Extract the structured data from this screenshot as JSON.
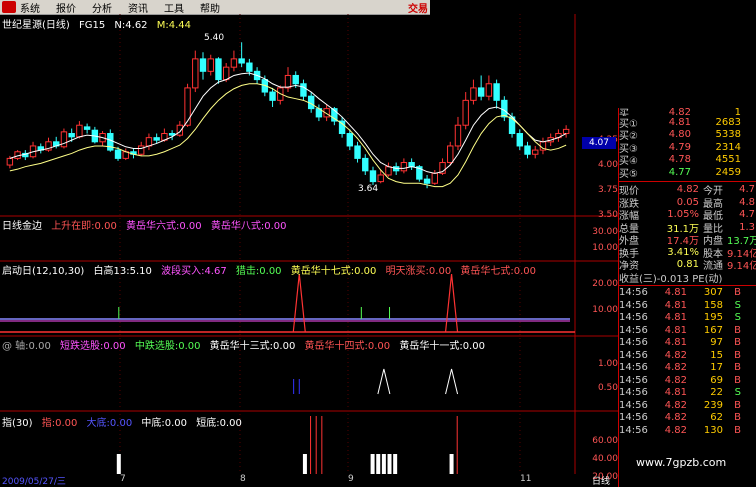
{
  "menu": {
    "items": [
      "系统",
      "报价",
      "分析",
      "资讯",
      "工具",
      "帮助"
    ],
    "trade": "交易"
  },
  "main_title": {
    "name": "世纪星源(日线)",
    "code": "FG15",
    "n": "N:4.62",
    "m": "M:4.44"
  },
  "price_chart": {
    "axis": [
      "4.25",
      "4.00",
      "3.75",
      "3.50"
    ],
    "current_price": "4.07",
    "high_label": "5.40",
    "low_label": "3.64",
    "candles": [
      [
        3.92,
        4.0,
        3.88,
        4.03
      ],
      [
        4.0,
        4.08,
        3.98,
        4.1
      ],
      [
        4.06,
        4.02,
        3.98,
        4.1
      ],
      [
        4.02,
        4.15,
        4.0,
        4.2
      ],
      [
        4.14,
        4.1,
        4.06,
        4.18
      ],
      [
        4.1,
        4.2,
        4.08,
        4.25
      ],
      [
        4.2,
        4.15,
        4.12,
        4.26
      ],
      [
        4.14,
        4.32,
        4.12,
        4.36
      ],
      [
        4.3,
        4.26,
        4.2,
        4.36
      ],
      [
        4.26,
        4.4,
        4.24,
        4.45
      ],
      [
        4.38,
        4.35,
        4.3,
        4.42
      ],
      [
        4.34,
        4.2,
        4.18,
        4.38
      ],
      [
        4.2,
        4.3,
        4.15,
        4.33
      ],
      [
        4.3,
        4.1,
        4.08,
        4.35
      ],
      [
        4.1,
        4.0,
        3.97,
        4.14
      ],
      [
        4.0,
        4.08,
        3.98,
        4.12
      ],
      [
        4.08,
        4.05,
        4.0,
        4.12
      ],
      [
        4.05,
        4.15,
        4.03,
        4.2
      ],
      [
        4.15,
        4.25,
        4.1,
        4.3
      ],
      [
        4.25,
        4.22,
        4.18,
        4.3
      ],
      [
        4.22,
        4.3,
        4.2,
        4.36
      ],
      [
        4.3,
        4.28,
        4.22,
        4.34
      ],
      [
        4.28,
        4.4,
        4.26,
        4.45
      ],
      [
        4.4,
        4.85,
        4.38,
        4.9
      ],
      [
        4.85,
        5.2,
        4.8,
        5.3
      ],
      [
        5.2,
        5.05,
        4.95,
        5.28
      ],
      [
        5.05,
        5.2,
        5.0,
        5.25
      ],
      [
        5.2,
        4.95,
        4.9,
        5.22
      ],
      [
        4.95,
        5.1,
        4.92,
        5.15
      ],
      [
        5.1,
        5.2,
        5.05,
        5.3
      ],
      [
        5.2,
        5.15,
        5.1,
        5.4
      ],
      [
        5.15,
        5.05,
        5.0,
        5.2
      ],
      [
        5.05,
        4.95,
        4.9,
        5.1
      ],
      [
        4.95,
        4.8,
        4.75,
        5.0
      ],
      [
        4.8,
        4.7,
        4.62,
        4.85
      ],
      [
        4.7,
        4.85,
        4.65,
        4.88
      ],
      [
        4.85,
        5.0,
        4.8,
        5.1
      ],
      [
        5.0,
        4.9,
        4.85,
        5.05
      ],
      [
        4.9,
        4.75,
        4.7,
        4.95
      ],
      [
        4.75,
        4.6,
        4.55,
        4.8
      ],
      [
        4.6,
        4.5,
        4.45,
        4.65
      ],
      [
        4.5,
        4.6,
        4.45,
        4.65
      ],
      [
        4.6,
        4.45,
        4.4,
        4.62
      ],
      [
        4.45,
        4.3,
        4.25,
        4.5
      ],
      [
        4.3,
        4.15,
        4.1,
        4.35
      ],
      [
        4.15,
        4.0,
        3.95,
        4.2
      ],
      [
        4.0,
        3.85,
        3.8,
        4.05
      ],
      [
        3.85,
        3.72,
        3.68,
        3.9
      ],
      [
        3.72,
        3.8,
        3.7,
        3.86
      ],
      [
        3.8,
        3.9,
        3.78,
        3.95
      ],
      [
        3.9,
        3.85,
        3.8,
        3.95
      ],
      [
        3.85,
        3.95,
        3.82,
        4.0
      ],
      [
        3.95,
        3.9,
        3.86,
        4.0
      ],
      [
        3.9,
        3.75,
        3.72,
        3.92
      ],
      [
        3.75,
        3.7,
        3.64,
        3.8
      ],
      [
        3.7,
        3.82,
        3.68,
        3.86
      ],
      [
        3.82,
        3.95,
        3.8,
        4.0
      ],
      [
        3.95,
        4.15,
        3.92,
        4.2
      ],
      [
        4.15,
        4.4,
        4.1,
        4.5
      ],
      [
        4.4,
        4.7,
        4.35,
        4.8
      ],
      [
        4.7,
        4.85,
        4.65,
        4.95
      ],
      [
        4.85,
        4.75,
        4.7,
        5.0
      ],
      [
        4.75,
        4.9,
        4.7,
        5.0
      ],
      [
        4.9,
        4.7,
        4.6,
        4.95
      ],
      [
        4.7,
        4.5,
        4.45,
        4.75
      ],
      [
        4.5,
        4.3,
        4.25,
        4.55
      ],
      [
        4.3,
        4.15,
        4.1,
        4.35
      ],
      [
        4.15,
        4.05,
        4.0,
        4.2
      ],
      [
        4.05,
        4.1,
        4.0,
        4.15
      ],
      [
        4.1,
        4.2,
        4.05,
        4.25
      ],
      [
        4.2,
        4.25,
        4.15,
        4.3
      ],
      [
        4.25,
        4.3,
        4.2,
        4.35
      ],
      [
        4.3,
        4.35,
        4.25,
        4.4
      ]
    ],
    "ma1": [
      4.0,
      4.03,
      4.05,
      4.08,
      4.1,
      4.12,
      4.15,
      4.18,
      4.22,
      4.26,
      4.28,
      4.27,
      4.25,
      4.22,
      4.18,
      4.14,
      4.12,
      4.12,
      4.15,
      4.18,
      4.22,
      4.26,
      4.32,
      4.45,
      4.6,
      4.75,
      4.85,
      4.92,
      4.95,
      5.0,
      5.02,
      5.03,
      5.0,
      4.96,
      4.9,
      4.86,
      4.86,
      4.88,
      4.86,
      4.8,
      4.72,
      4.65,
      4.58,
      4.5,
      4.4,
      4.3,
      4.18,
      4.05,
      3.95,
      3.9,
      3.88,
      3.88,
      3.9,
      3.88,
      3.84,
      3.82,
      3.84,
      3.92,
      4.05,
      4.22,
      4.4,
      4.52,
      4.6,
      4.62,
      4.58,
      4.5,
      4.4,
      4.3,
      4.22,
      4.2,
      4.22,
      4.25,
      4.3
    ],
    "ma2": [
      3.85,
      3.87,
      3.9,
      3.92,
      3.94,
      3.97,
      4.0,
      4.03,
      4.06,
      4.1,
      4.13,
      4.15,
      4.15,
      4.14,
      4.12,
      4.08,
      4.05,
      4.03,
      4.03,
      4.05,
      4.08,
      4.12,
      4.16,
      4.24,
      4.35,
      4.48,
      4.6,
      4.7,
      4.78,
      4.84,
      4.88,
      4.9,
      4.9,
      4.88,
      4.84,
      4.78,
      4.74,
      4.72,
      4.7,
      4.66,
      4.6,
      4.54,
      4.48,
      4.42,
      4.34,
      4.24,
      4.12,
      3.98,
      3.86,
      3.76,
      3.72,
      3.7,
      3.7,
      3.7,
      3.68,
      3.66,
      3.66,
      3.7,
      3.8,
      3.96,
      4.14,
      4.3,
      4.42,
      4.5,
      4.52,
      4.48,
      4.4,
      4.3,
      4.2,
      4.12,
      4.1,
      4.12,
      4.16
    ]
  },
  "panel1": {
    "title": "日线金边",
    "items": [
      {
        "t": "上升在即:0.00",
        "c": "#ff5555"
      },
      {
        "t": "黄岳华六式:0.00",
        "c": "#ff55ff"
      },
      {
        "t": "黄岳华八式:0.00",
        "c": "#ff55ff"
      }
    ],
    "axis": [
      "30.00",
      "10.00"
    ]
  },
  "panel2": {
    "title": "启动日(12,10,30)",
    "items": [
      {
        "t": "白高13:5.10",
        "c": "#ffffff"
      },
      {
        "t": "波段买入:4.67",
        "c": "#ff55ff"
      },
      {
        "t": "猎击:0.00",
        "c": "#55ff55"
      },
      {
        "t": "黄岳华十七式:0.00",
        "c": "#ffff55"
      },
      {
        "t": "明天涨买:0.00",
        "c": "#ff5555"
      },
      {
        "t": "黄岳华七式:0.00",
        "c": "#ff5555"
      }
    ],
    "axis": [
      "20.00",
      "10.00"
    ]
  },
  "panel3": {
    "title": "@ 轴:0.00",
    "items": [
      {
        "t": "短跌选股:0.00",
        "c": "#ff55ff"
      },
      {
        "t": "中跌选股:0.00",
        "c": "#55ff55"
      },
      {
        "t": "黄岳华十三式:0.00",
        "c": "#ffffff"
      },
      {
        "t": "黄岳华十四式:0.00",
        "c": "#ff5555"
      },
      {
        "t": "黄岳华十一式:0.00",
        "c": "#ffffff"
      }
    ],
    "axis": [
      "1.00",
      "0.50"
    ]
  },
  "panel4": {
    "title": "指(30)",
    "items": [
      {
        "t": "指:0.00",
        "c": "#ff5555"
      },
      {
        "t": "大底:0.00",
        "c": "#5555ff"
      },
      {
        "t": "中底:0.00",
        "c": "#ffffff"
      },
      {
        "t": "短底:0.00",
        "c": "#ffffff"
      }
    ],
    "axis": [
      "60.00",
      "40.00",
      "20.00"
    ]
  },
  "bottom": {
    "date": "2009/05/27/三",
    "months": [
      "7",
      "8",
      "9",
      "11"
    ],
    "period": "日线"
  },
  "order_book": [
    {
      "l": "买①",
      "p": "4.81",
      "q": "2683"
    },
    {
      "l": "买②",
      "p": "4.80",
      "q": "5338"
    },
    {
      "l": "买③",
      "p": "4.79",
      "q": "2314"
    },
    {
      "l": "买④",
      "p": "4.78",
      "q": "4551"
    },
    {
      "l": "买⑤",
      "p": "4.77",
      "q": "2459"
    }
  ],
  "order_book_top": {
    "l": "买",
    "p": "4.82",
    "q": "1"
  },
  "stats": [
    {
      "a": "现价",
      "b": "4.82",
      "c": "今开",
      "d": "4.7"
    },
    {
      "a": "涨跌",
      "b": "0.05",
      "c": "最高",
      "d": "4.8"
    },
    {
      "a": "涨幅",
      "b": "1.05%",
      "c": "最低",
      "d": "4.7"
    },
    {
      "a": "总量",
      "b": "31.1万",
      "c": "量比",
      "d": "1.3"
    },
    {
      "a": "外盘",
      "b": "17.4万",
      "c": "内盘",
      "d": "13.7万"
    },
    {
      "a": "换手",
      "b": "3.41%",
      "c": "股本",
      "d": "9.14亿"
    },
    {
      "a": "净资",
      "b": "0.81",
      "c": "流通",
      "d": "9.14亿"
    }
  ],
  "earnings": "收益(三)-0.013 PE(动)",
  "ticks": [
    {
      "t": "14:56",
      "p": "4.81",
      "n": "307",
      "s": "B"
    },
    {
      "t": "14:56",
      "p": "4.81",
      "n": "158",
      "s": "S"
    },
    {
      "t": "14:56",
      "p": "4.81",
      "n": "195",
      "s": "S"
    },
    {
      "t": "14:56",
      "p": "4.81",
      "n": "167",
      "s": "B"
    },
    {
      "t": "14:56",
      "p": "4.81",
      "n": "97",
      "s": "B"
    },
    {
      "t": "14:56",
      "p": "4.82",
      "n": "15",
      "s": "B"
    },
    {
      "t": "14:56",
      "p": "4.82",
      "n": "17",
      "s": "B"
    },
    {
      "t": "14:56",
      "p": "4.82",
      "n": "69",
      "s": "B"
    },
    {
      "t": "14:56",
      "p": "4.81",
      "n": "22",
      "s": "S"
    },
    {
      "t": "14:56",
      "p": "4.82",
      "n": "239",
      "s": "B"
    },
    {
      "t": "14:56",
      "p": "4.82",
      "n": "62",
      "s": "B"
    },
    {
      "t": "14:56",
      "p": "4.82",
      "n": "130",
      "s": "B"
    }
  ],
  "panel2_spikes": [
    0.52,
    0.79
  ],
  "panel3_spikes": [
    0.67,
    0.79
  ],
  "panel4_bars": {
    "white": [
      0.2,
      0.53,
      0.65,
      0.66,
      0.67,
      0.68,
      0.69,
      0.79
    ],
    "red": [
      0.54,
      0.55,
      0.56,
      0.8
    ]
  },
  "watermark": "www.7gpzb.com"
}
